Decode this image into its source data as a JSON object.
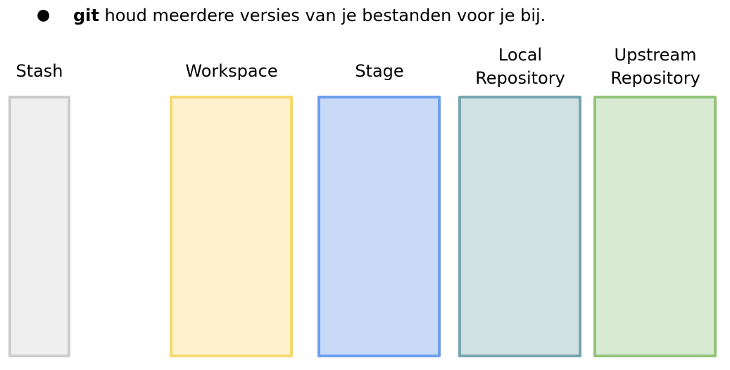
{
  "bullet": {
    "marker": "●",
    "keyword": "git",
    "rest": " houd meerdere versies van je bestanden voor je bij."
  },
  "areas": [
    {
      "id": "stash",
      "label_lines": [
        "Stash"
      ],
      "fill": "#efefef",
      "border": "#cccccc"
    },
    {
      "id": "workspace",
      "label_lines": [
        "Workspace"
      ],
      "fill": "#fff2cc",
      "border": "#f6d86f"
    },
    {
      "id": "stage",
      "label_lines": [
        "Stage"
      ],
      "fill": "#c9daf8",
      "border": "#6d9eeb"
    },
    {
      "id": "local-repository",
      "label_lines": [
        "Local",
        "Repository"
      ],
      "fill": "#d0e0e3",
      "border": "#76a5af"
    },
    {
      "id": "upstream-repository",
      "label_lines": [
        "Upstream",
        "Repository"
      ],
      "fill": "#d9ead3",
      "border": "#93c47d"
    }
  ]
}
